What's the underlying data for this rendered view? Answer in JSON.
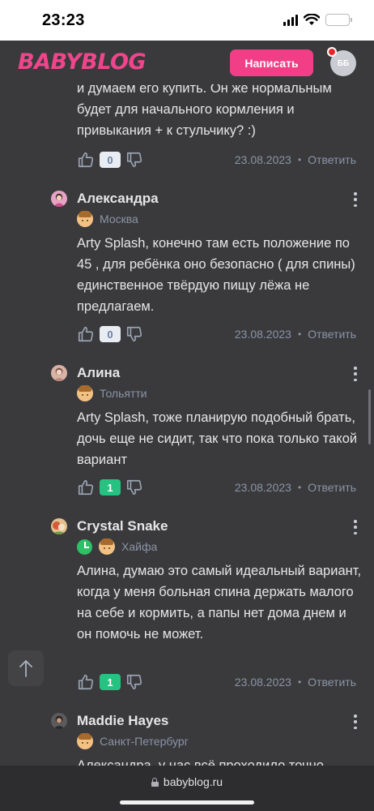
{
  "status_bar": {
    "time": "23:23"
  },
  "header": {
    "logo": "BABYBLOG",
    "write_button": "Написать",
    "avatar_initials": "ББ"
  },
  "top_comment": {
    "text": "и думаем его купить. Он же нормальным будет для начального кормления и привыкания + к стульчику? :)",
    "likes": "0",
    "date": "23.08.2023",
    "reply": "Ответить"
  },
  "comments": [
    {
      "name": "Александра",
      "city": "Москва",
      "text": "Arty Splash, конечно там есть положение по 45 , для ребёнка оно безопасно ( для спины) единственное твёрдую пищу лёжа не предлагаем.",
      "likes": "0",
      "date": "23.08.2023",
      "reply": "Ответить"
    },
    {
      "name": "Алина",
      "city": "Тольятти",
      "text": "Arty Splash, тоже планирую подобный брать, дочь еще не сидит, так что пока только такой вариант",
      "likes": "1",
      "date": "23.08.2023",
      "reply": "Ответить"
    },
    {
      "name": "Crystal Snake",
      "city": "Хайфа",
      "text": "Алина, думаю это самый идеальный вариант, когда у меня больная спина держать малого на себе и кормить, а папы нет дома днем и он помочь не может.",
      "likes": "1",
      "date": "23.08.2023",
      "reply": "Ответить"
    },
    {
      "name": "Maddie Hayes",
      "city": "Санкт-Петербург",
      "text": "Александра, у нас всё проходило точно"
    }
  ],
  "browser": {
    "url": "babyblog.ru"
  },
  "colors": {
    "accent": "#f13e87",
    "positive": "#26c281",
    "background": "#3a3a3c"
  },
  "icons": [
    "like-icon",
    "dislike-icon",
    "more-icon",
    "arrow-up-icon",
    "lock-icon",
    "clock-icon",
    "wifi-icon",
    "signal-icon",
    "battery-icon"
  ]
}
